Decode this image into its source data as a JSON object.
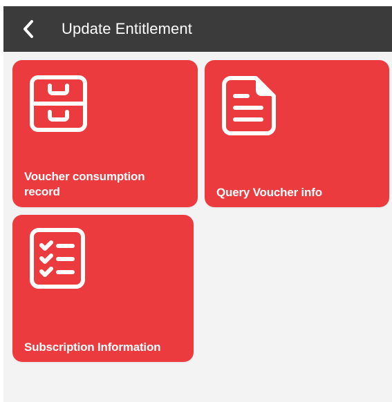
{
  "appbar": {
    "title": "Update Entitlement",
    "back_icon": "chevron-left-icon",
    "background": "#3b3b3b"
  },
  "tiles": [
    {
      "label": "Voucher consumption record",
      "icon": "file-cabinet-icon"
    },
    {
      "label": "Query Voucher info",
      "icon": "document-icon"
    },
    {
      "label": "Subscription Information",
      "icon": "checklist-icon"
    }
  ],
  "colors": {
    "tile": "#ec3b3f",
    "page_background": "#f3f3f3",
    "text_on_tile": "#ffffff"
  }
}
